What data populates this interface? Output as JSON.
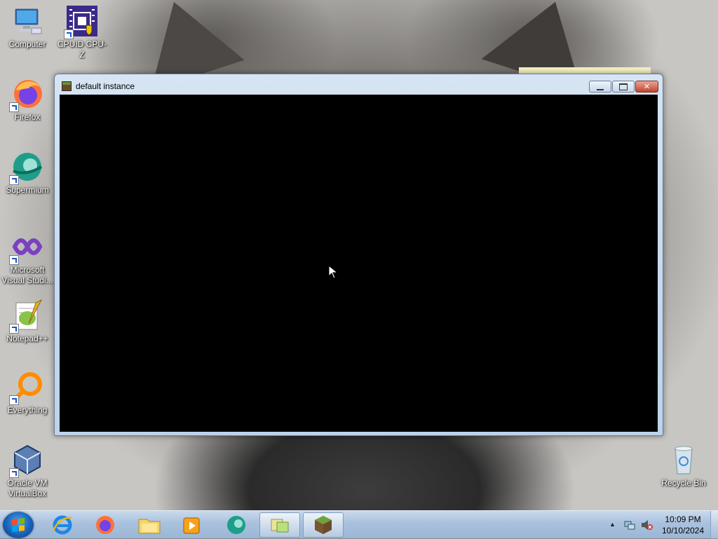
{
  "desktop": {
    "icons": [
      {
        "label": "Computer"
      },
      {
        "label": "CPUID CPU-Z"
      },
      {
        "label": "Firefox"
      },
      {
        "label": "Supermium"
      },
      {
        "label": "Microsoft Visual Studi..."
      },
      {
        "label": "Notepad++"
      },
      {
        "label": "Everything"
      },
      {
        "label": "Oracle VM VirtualBox"
      },
      {
        "label": "Recycle Bin"
      }
    ]
  },
  "window": {
    "title": "default instance",
    "icon": "minecraft-grass-block-icon",
    "buttons": {
      "minimize": "minimize",
      "maximize": "maximize",
      "close": "close"
    },
    "content_color": "#000000"
  },
  "taskbar": {
    "start": "start-orb-icon",
    "pinned": [
      {
        "name": "internet-explorer-icon"
      },
      {
        "name": "firefox-icon"
      },
      {
        "name": "file-explorer-icon"
      },
      {
        "name": "media-player-icon"
      },
      {
        "name": "supermium-icon"
      },
      {
        "name": "sticky-notes-icon"
      },
      {
        "name": "minecraft-icon"
      }
    ],
    "tray": {
      "time": "10:09 PM",
      "date": "10/10/2024"
    }
  },
  "colors": {
    "taskbar_bg": "#a9c1dd",
    "window_frame": "#bcd3ea",
    "close_button": "#c5442c"
  }
}
